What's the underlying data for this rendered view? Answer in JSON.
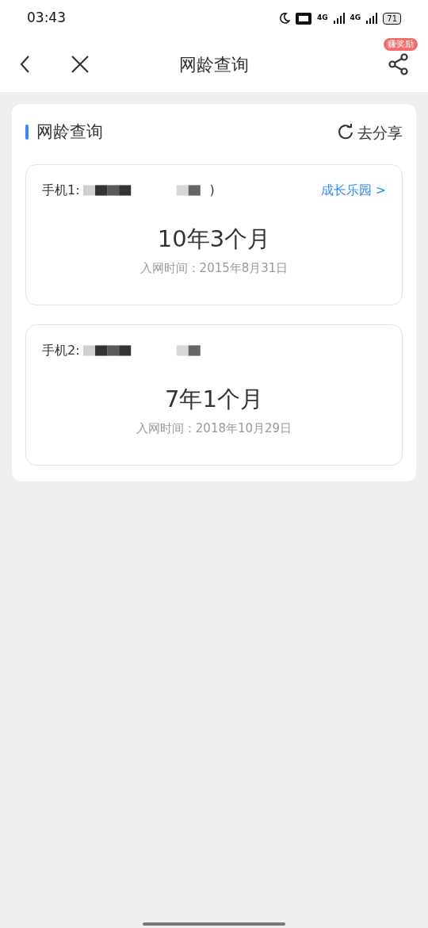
{
  "status_bar": {
    "time": "03:43",
    "network_1": "4G",
    "network_2": "4G",
    "battery": "71"
  },
  "nav": {
    "title": "网龄查询",
    "badge": "赚奖励"
  },
  "section": {
    "title": "网龄查询",
    "share": "去分享"
  },
  "phones": [
    {
      "label": "手机1:",
      "suffix": ")",
      "link": "成长乐园 >",
      "age": "10年3个月",
      "since": "入网时间：2015年8月31日"
    },
    {
      "label": "手机2:",
      "age": "7年1个月",
      "since": "入网时间：2018年10月29日"
    }
  ]
}
